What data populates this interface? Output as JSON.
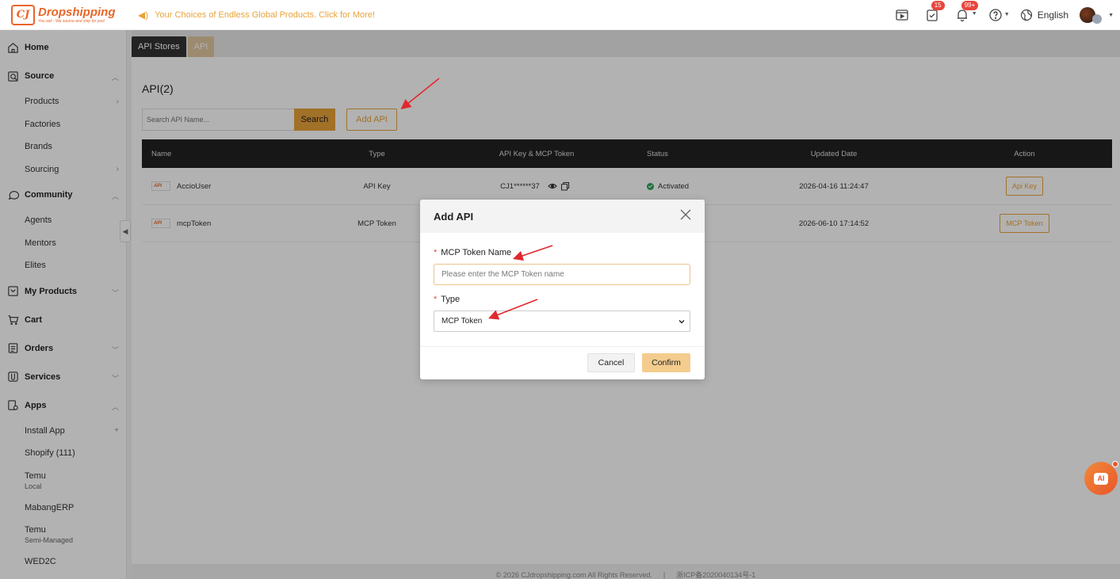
{
  "brand": {
    "name": "Dropshipping",
    "tagline": "You sell - We source and ship for you!",
    "mark": "CJ"
  },
  "announcement": "Your Choices of Endless Global Products. Click for More!",
  "topbar": {
    "video_icon": "video-icon",
    "orders_badge": "15",
    "notify_badge": "99+",
    "language": "English"
  },
  "sidebar": {
    "home": "Home",
    "source": "Source",
    "source_items": [
      "Products",
      "Factories",
      "Brands",
      "Sourcing"
    ],
    "community": "Community",
    "community_items": [
      "Agents",
      "Mentors",
      "Elites"
    ],
    "my_products": "My Products",
    "cart": "Cart",
    "orders": "Orders",
    "services": "Services",
    "apps": "Apps",
    "apps_items": {
      "install": "Install App",
      "shopify": "Shopify (111)",
      "temu_local": "Temu",
      "temu_local_sub": "Local",
      "mabang": "MabangERP",
      "temu_semi": "Temu",
      "temu_semi_sub": "Semi-Managed",
      "wed2c": "WED2C"
    }
  },
  "tabs": {
    "api_stores": "API Stores",
    "api": "API"
  },
  "page": {
    "title": "API(2)",
    "search_placeholder": "Search API Name...",
    "search_button": "Search",
    "add_button": "Add API"
  },
  "table": {
    "headers": {
      "name": "Name",
      "type": "Type",
      "key": "API Key & MCP Token",
      "status": "Status",
      "updated": "Updated Date",
      "action": "Action"
    },
    "rows": [
      {
        "name": "AccioUser",
        "type": "API Key",
        "key": "CJ1******37",
        "status": "Activated",
        "updated": "2026-04-16 11:24:47",
        "action": "Api Key"
      },
      {
        "name": "mcpToken",
        "type": "MCP Token",
        "key": "",
        "status": "",
        "updated": "2026-06-10 17:14:52",
        "action": "MCP Token"
      }
    ],
    "logo_text": "API"
  },
  "footer": {
    "copyright": "©  2026 CJdropshipping.com All Rights Reserved.",
    "divider": "|",
    "icp": "浙ICP备2020040134号-1"
  },
  "ai_label": "AI",
  "modal": {
    "title": "Add API",
    "name_label": "MCP Token Name",
    "name_placeholder": "Please enter the MCP Token name",
    "type_label": "Type",
    "type_value": "MCP Token",
    "cancel": "Cancel",
    "confirm": "Confirm",
    "required_mark": "*"
  },
  "colors": {
    "accent": "#e8a33a",
    "brand": "#e8662a",
    "annotation": "#e0282e"
  }
}
